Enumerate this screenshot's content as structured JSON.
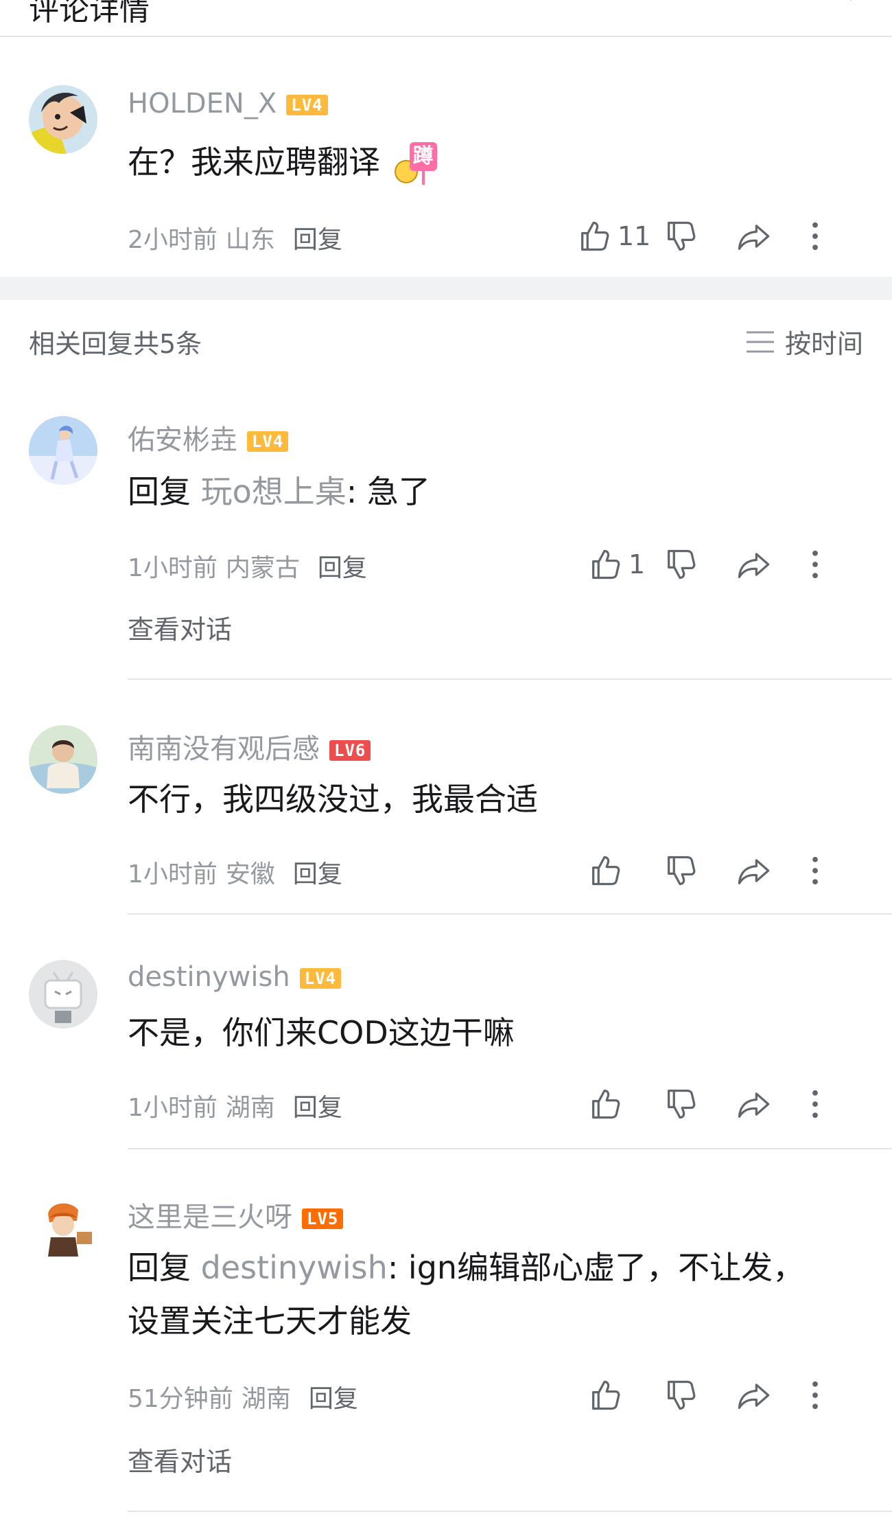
{
  "header": {
    "title": "评论详情"
  },
  "main_comment": {
    "username": "HOLDEN_X",
    "level": "LV4",
    "text": "在？我来应聘翻译",
    "sticker_text": "蹲",
    "time": "2小时前",
    "location": "山东",
    "reply_label": "回复",
    "like_count": "11"
  },
  "replies_header": {
    "count_label": "相关回复共5条",
    "sort_label": "按时间"
  },
  "replies": [
    {
      "username": "佑安彬垚",
      "level": "LV4",
      "reply_prefix": "回复",
      "reply_target": "玩o想上桌",
      "text": ": 急了",
      "time": "1小时前",
      "location": "内蒙古",
      "reply_label": "回复",
      "like_count": "1",
      "view_dialog": "查看对话"
    },
    {
      "username": "南南没有观后感",
      "level": "LV6",
      "text": "不行，我四级没过，我最合适",
      "time": "1小时前",
      "location": "安徽",
      "reply_label": "回复"
    },
    {
      "username": "destinywish",
      "level": "LV4",
      "text": "不是，你们来COD这边干嘛",
      "time": "1小时前",
      "location": "湖南",
      "reply_label": "回复"
    },
    {
      "username": "这里是三火呀",
      "level": "LV5",
      "reply_prefix": "回复",
      "reply_target": "destinywish",
      "text": ": ign编辑部心虚了，不让发，",
      "text_line2": "设置关注七天才能发",
      "time": "51分钟前",
      "location": "湖南",
      "reply_label": "回复",
      "view_dialog": "查看对话"
    }
  ],
  "colors": {
    "text": "#18191c",
    "secondary": "#9499a0",
    "meta": "#61666d",
    "lv4": "#ffb93b",
    "lv5": "#ff6c00",
    "lv6": "#ee4d4d"
  }
}
